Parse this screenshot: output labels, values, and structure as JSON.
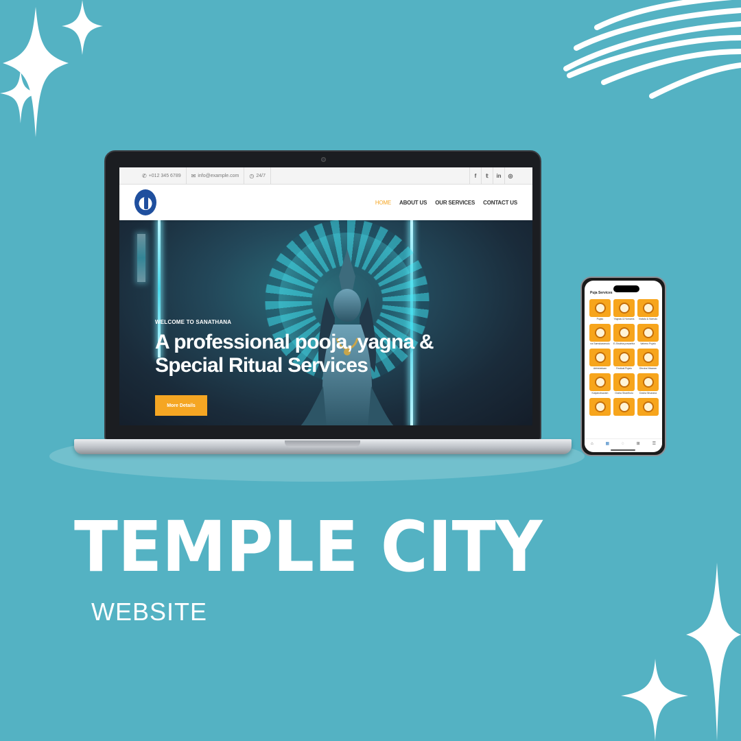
{
  "colors": {
    "background": "#54b2c3",
    "accent": "#f5a623",
    "white": "#ffffff"
  },
  "website": {
    "topbar": {
      "phone": "+012 345 6789",
      "email": "info@example.com",
      "hours": "24/7",
      "socials": [
        "f",
        "t",
        "in",
        "ig"
      ]
    },
    "nav": {
      "items": [
        {
          "label": "HOME",
          "active": true
        },
        {
          "label": "ABOUT US",
          "active": false
        },
        {
          "label": "OUR SERVICES",
          "active": false
        },
        {
          "label": "CONTACT US",
          "active": false
        }
      ]
    },
    "hero": {
      "kicker": "WELCOME TO SANATHANA",
      "title": "A professional pooja, yagna & Special Ritual Services",
      "button": "More Details"
    }
  },
  "app": {
    "title": "Puja Services",
    "tiles": [
      "Pujalu",
      "Yagnas & Homams",
      "Vratalu & Nomulu",
      "na Samskaramulu",
      "E-Shubha pravarthan",
      "Vaheno Pujalu",
      "Abhishekam",
      "Festival Pujalu",
      "Dhruha Niwaran",
      "Kalyanotsavam",
      "Graha Shanthulu",
      "Dosha Nivarana",
      "",
      "",
      ""
    ],
    "tabbar": [
      "home-icon",
      "category-icon",
      "chat-icon",
      "cart-icon",
      "menu-icon"
    ],
    "tab_selected_label": "Category"
  },
  "headline": "TEMPLE CITY",
  "subline": "WEBSITE"
}
